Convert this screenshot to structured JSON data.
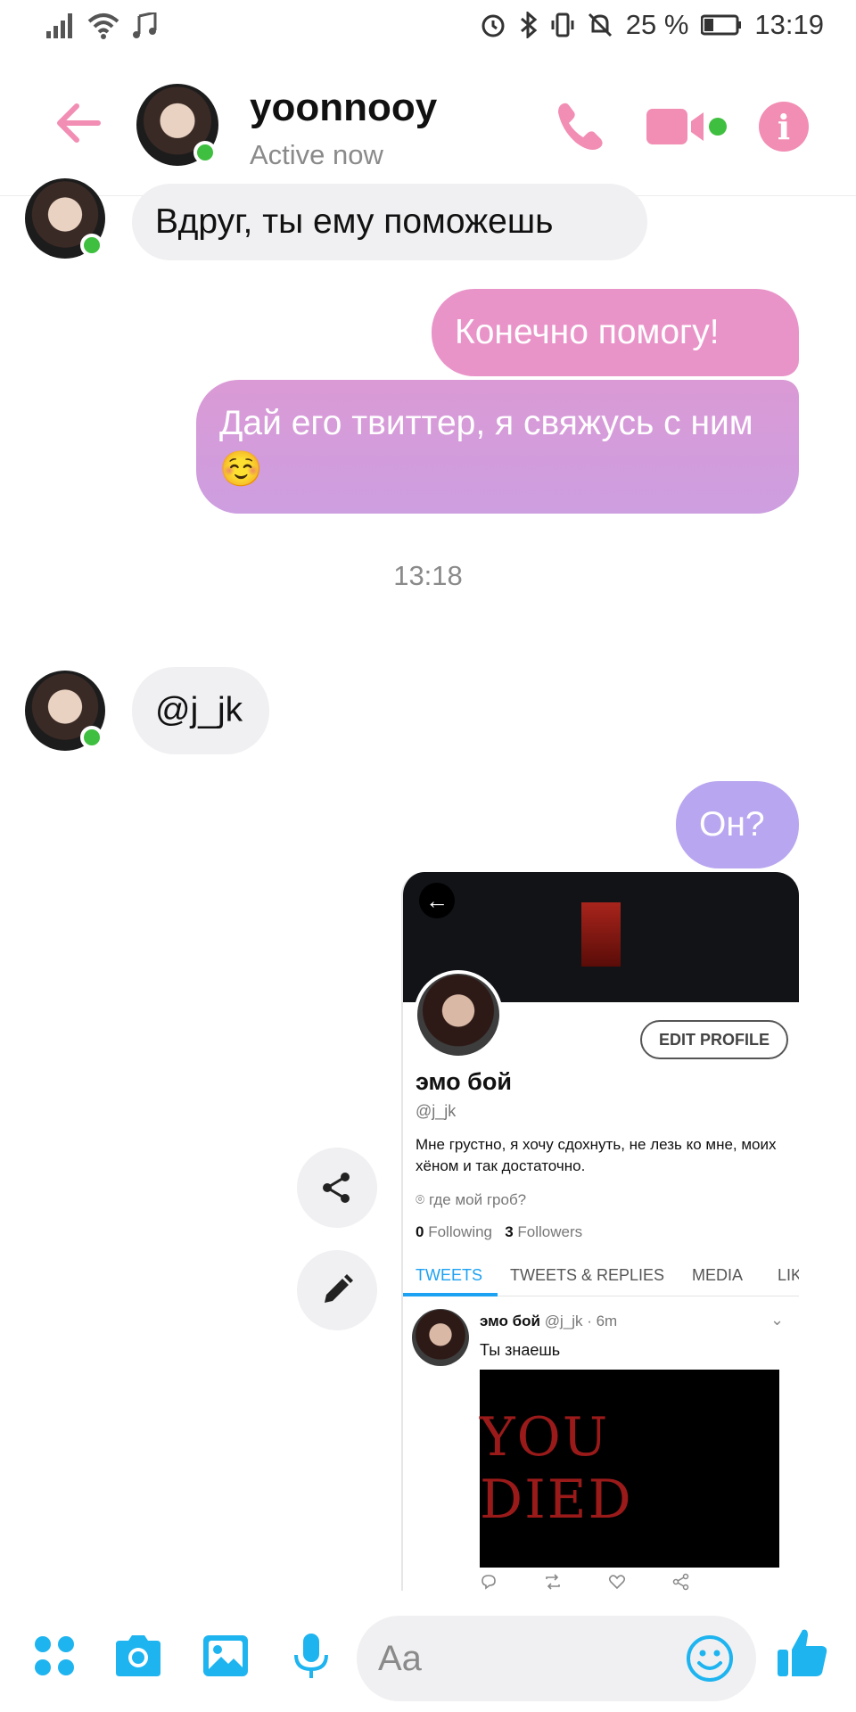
{
  "status_bar": {
    "battery_percent": "25 %",
    "time": "13:19",
    "icons": [
      "signal-icon",
      "wifi-icon",
      "music-note-icon",
      "alarm-icon",
      "bluetooth-icon",
      "vibrate-icon",
      "silent-icon",
      "battery-icon"
    ]
  },
  "header": {
    "name": "yoonnooy",
    "status": "Active now",
    "accent_color": "#f28db3"
  },
  "messages": [
    {
      "direction": "in",
      "text": "Вдруг, ты ему поможешь"
    },
    {
      "direction": "out",
      "text": "Конечно помогу!"
    },
    {
      "direction": "out",
      "text": "Дай его твиттер, я свяжусь с ним ☺️"
    },
    {
      "type": "timestamp",
      "text": "13:18"
    },
    {
      "direction": "in",
      "text": "@j_jk"
    },
    {
      "direction": "out",
      "text": "Он?"
    }
  ],
  "shared_screenshot": {
    "edit_profile": "EDIT PROFILE",
    "name": "эмо бой",
    "handle": "@j_jk",
    "bio": "Мне грустно, я хочу сдохнуть, не лезь ко мне, моих хёном и так достаточно.",
    "location": "где мой гроб?",
    "following_count": "0",
    "following_label": "Following",
    "followers_count": "3",
    "followers_label": "Followers",
    "tabs": [
      "TWEETS",
      "TWEETS & REPLIES",
      "MEDIA",
      "LIK"
    ],
    "tweet": {
      "name": "эмо бой",
      "meta": "@j_jk · 6m",
      "text": "Ты знаешь",
      "media_text": "YOU DIED"
    }
  },
  "composer": {
    "placeholder": "Aa",
    "accent_color": "#1eb4f0"
  }
}
